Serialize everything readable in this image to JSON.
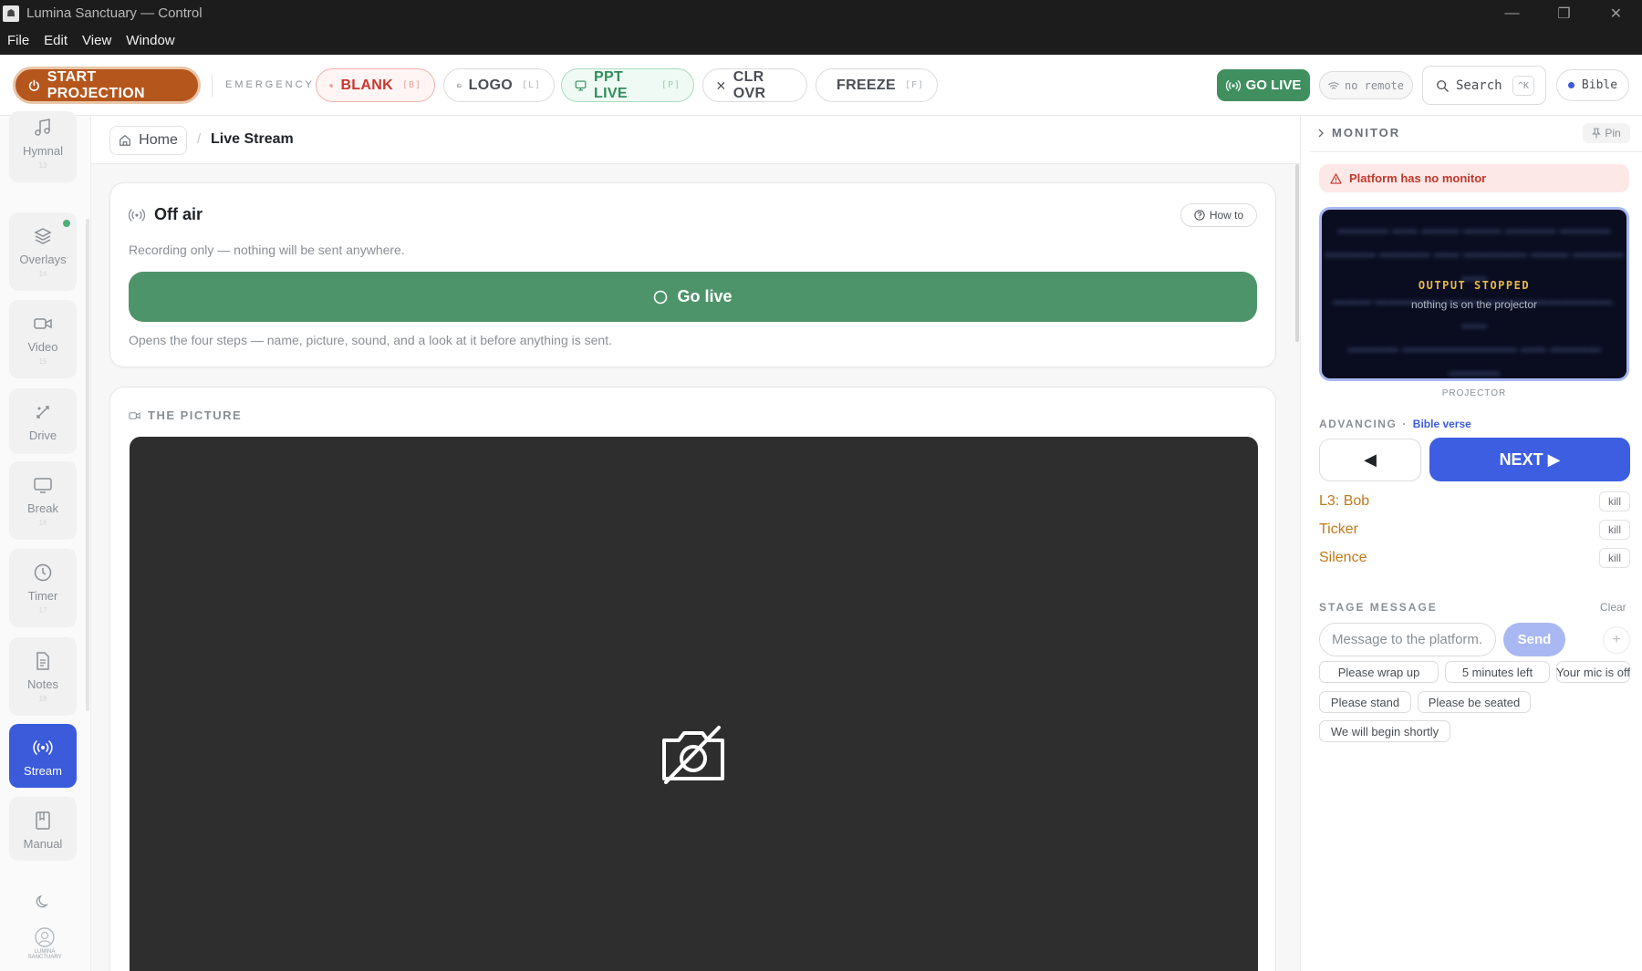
{
  "window": {
    "title": "Lumina Sanctuary — Control",
    "controls": [
      "—",
      "❐",
      "✕"
    ]
  },
  "menu": [
    "File",
    "Edit",
    "View",
    "Window"
  ],
  "toolbar": {
    "start_projection": "START PROJECTION",
    "emergency_label": "EMERGENCY",
    "blank": {
      "label": "BLANK",
      "key": "[B]"
    },
    "logo": {
      "label": "LOGO",
      "key": "[L]"
    },
    "ppt_live": {
      "label": "PPT LIVE",
      "key": "[P]"
    },
    "clr_ovr": {
      "label": "CLR OVR"
    },
    "freeze": {
      "label": "FREEZE",
      "key": "[F]"
    },
    "go_live": "GO LIVE",
    "remote": "no remote",
    "search": "Search",
    "search_kbd": "^K",
    "bible": "Bible"
  },
  "sidebar": {
    "items": [
      {
        "label": "Hymnal",
        "num": "13",
        "icon": "music-note-icon"
      },
      {
        "label": "Overlays",
        "num": "14",
        "icon": "layers-icon"
      },
      {
        "label": "Video",
        "num": "15",
        "icon": "video-icon"
      },
      {
        "label": "Drive",
        "num": "",
        "icon": "drive-icon"
      },
      {
        "label": "Break",
        "num": "16",
        "icon": "monitor-icon"
      },
      {
        "label": "Timer",
        "num": "17",
        "icon": "clock-icon"
      },
      {
        "label": "Notes",
        "num": "18",
        "icon": "notes-icon"
      },
      {
        "label": "Stream",
        "num": "",
        "icon": "broadcast-icon"
      },
      {
        "label": "Manual",
        "num": "",
        "icon": "book-icon"
      }
    ],
    "brand": "LUMINA SANCTUARY"
  },
  "breadcrumb": {
    "home": "Home",
    "separator": "/",
    "current": "Live Stream"
  },
  "offair": {
    "title": "Off air",
    "howto": "How to",
    "subtitle": "Recording only — nothing will be sent anywhere.",
    "golive": "Go live",
    "description": "Opens the four steps — name, picture, sound, and a look at it before anything is sent."
  },
  "picture": {
    "title": "THE PICTURE"
  },
  "monitor": {
    "title": "MONITOR",
    "pin": "Pin",
    "warning": "Platform has no monitor",
    "status": "OUTPUT STOPPED",
    "status_sub": "nothing is on the projector",
    "label": "PROJECTOR"
  },
  "advancing": {
    "label": "ADVANCING",
    "separator": "·",
    "mode": "Bible verse",
    "prev": "◀",
    "next": "NEXT ▶"
  },
  "overlays": [
    {
      "name": "L3: Bob",
      "action": "kill"
    },
    {
      "name": "Ticker",
      "action": "kill"
    },
    {
      "name": "Silence",
      "action": "kill"
    }
  ],
  "stage": {
    "title": "STAGE MESSAGE",
    "clear": "Clear",
    "placeholder": "Message to the platform...",
    "send": "Send",
    "add": "+",
    "presets": [
      "Please wrap up",
      "5 minutes left",
      "Your mic is off",
      "Please stand",
      "Please be seated",
      "We will begin shortly"
    ]
  },
  "colors": {
    "accent": "#3d5ee1",
    "go_live": "#3f8f5f",
    "start_projection": "#b5561d",
    "danger": "#c8372d",
    "overlay_name": "#c27a1b"
  }
}
